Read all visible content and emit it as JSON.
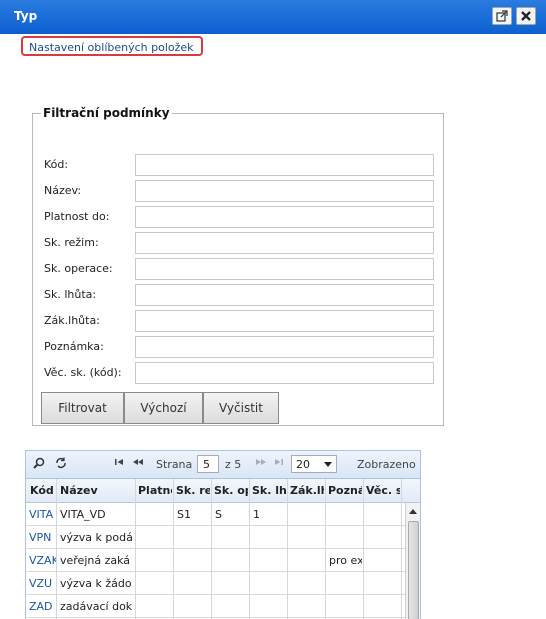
{
  "window": {
    "title": "Typ"
  },
  "favorites_link": "Nastavení oblíbených položek",
  "filter": {
    "legend": "Filtrační podmínky",
    "fields": [
      {
        "label": "Kód:",
        "value": ""
      },
      {
        "label": "Název:",
        "value": ""
      },
      {
        "label": "Platnost do:",
        "value": ""
      },
      {
        "label": "Sk. režim:",
        "value": ""
      },
      {
        "label": "Sk. operace:",
        "value": ""
      },
      {
        "label": "Sk. lhůta:",
        "value": ""
      },
      {
        "label": "Zák.lhůta:",
        "value": ""
      },
      {
        "label": "Poznámka:",
        "value": ""
      },
      {
        "label": "Věc. sk. (kód):",
        "value": ""
      }
    ],
    "buttons": {
      "filter": "Filtrovat",
      "default": "Výchozí",
      "clear": "Vyčistit"
    }
  },
  "grid": {
    "toolbar": {
      "page_label": "Strana",
      "page_value": "5",
      "of_label": "z 5",
      "page_size": "20",
      "display_label": "Zobrazeno"
    },
    "columns": [
      "Kód",
      "Název",
      "Platnc",
      "Sk. re",
      "Sk. op",
      "Sk. lhi",
      "Zák.lh",
      "Pozná",
      "Věc. s"
    ],
    "rows": [
      [
        "VITA",
        "VITA_VD",
        "",
        "S1",
        "S",
        "1",
        "",
        "",
        ""
      ],
      [
        "VPN",
        "výzva k podá",
        "",
        "",
        "",
        "",
        "",
        "",
        ""
      ],
      [
        "VZAK",
        "veřejná zaká",
        "",
        "",
        "",
        "",
        "",
        "pro ex",
        ""
      ],
      [
        "VZU",
        "výzva k žádo",
        "",
        "",
        "",
        "",
        "",
        "",
        ""
      ],
      [
        "ZAD",
        "zadávací dok",
        "",
        "",
        "",
        "",
        "",
        "",
        ""
      ]
    ]
  }
}
